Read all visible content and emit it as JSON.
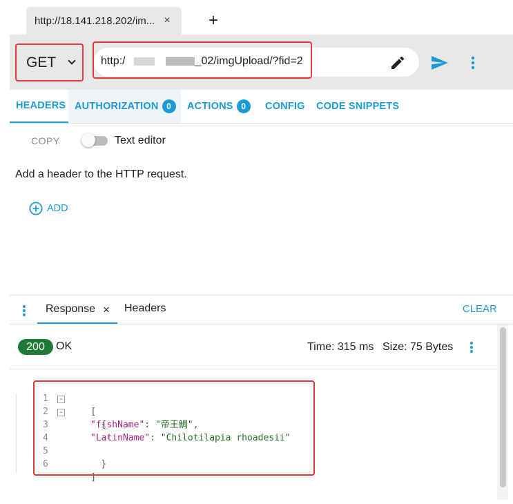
{
  "browser_tab": {
    "title": "http://18.141.218.202/im...",
    "close_glyph": "×",
    "new_tab_glyph": "+"
  },
  "request": {
    "method": "GET",
    "url_prefix": "http:/",
    "url_suffix": "_02/imgUpload/?fid=2",
    "icons": [
      "chevron-down-icon",
      "pencil-icon",
      "send-icon",
      "more-vert-icon"
    ]
  },
  "request_tabs": [
    {
      "label": "HEADERS"
    },
    {
      "label": "AUTHORIZATION",
      "badge": "0"
    },
    {
      "label": "ACTIONS",
      "badge": "0"
    },
    {
      "label": "CONFIG"
    },
    {
      "label": "CODE SNIPPETS"
    }
  ],
  "headers_panel": {
    "copy_label": "COPY",
    "text_editor_label": "Text editor",
    "hint": "Add a header to the HTTP request.",
    "add_label": "ADD"
  },
  "response_panel": {
    "tab_response": "Response",
    "tab_close": "×",
    "tab_headers": "Headers",
    "clear_label": "CLEAR",
    "status_code": "200",
    "status_text": "OK",
    "time": "Time: 315 ms",
    "size": "Size: 75 Bytes"
  },
  "response_body": {
    "line_numbers": [
      "1",
      "2",
      "3",
      "4",
      "5",
      "6"
    ],
    "fold_glyph": "-",
    "open_bracket": "[",
    "open_brace": "{",
    "key1": "\"fishName\"",
    "val1": "\"帝王鯛\"",
    "key2": "\"LatinName\"",
    "val2": "\"Chilotilapia rhoadesii\"",
    "colon": ": ",
    "comma": ",",
    "close_brace": "}",
    "close_bracket": "]"
  },
  "colors": {
    "accent": "#1a9bd7",
    "status_ok": "#1e7a35",
    "highlight_box": "#e53935",
    "json_key": "#a1247b",
    "json_string": "#236e25"
  }
}
